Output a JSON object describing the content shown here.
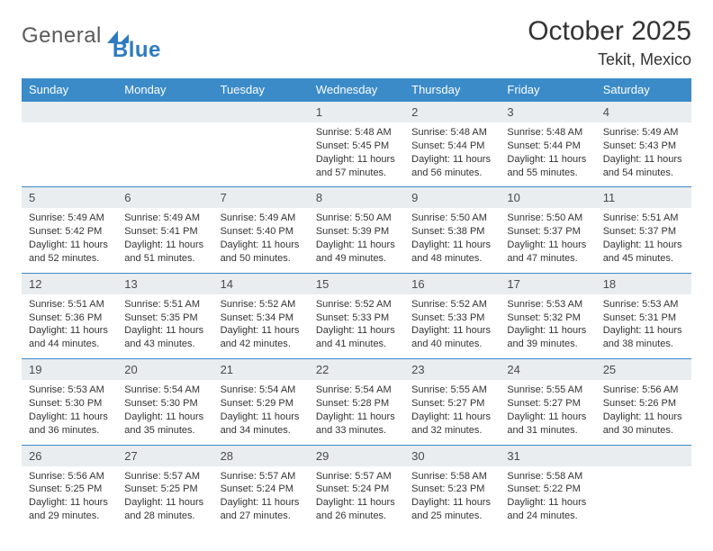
{
  "logo": {
    "word1": "General",
    "word2": "Blue"
  },
  "title": "October 2025",
  "location": "Tekit, Mexico",
  "dow": [
    "Sunday",
    "Monday",
    "Tuesday",
    "Wednesday",
    "Thursday",
    "Friday",
    "Saturday"
  ],
  "lead_blanks": 3,
  "days": [
    {
      "n": "1",
      "sr": "5:48 AM",
      "ss": "5:45 PM",
      "dl": "11 hours and 57 minutes."
    },
    {
      "n": "2",
      "sr": "5:48 AM",
      "ss": "5:44 PM",
      "dl": "11 hours and 56 minutes."
    },
    {
      "n": "3",
      "sr": "5:48 AM",
      "ss": "5:44 PM",
      "dl": "11 hours and 55 minutes."
    },
    {
      "n": "4",
      "sr": "5:49 AM",
      "ss": "5:43 PM",
      "dl": "11 hours and 54 minutes."
    },
    {
      "n": "5",
      "sr": "5:49 AM",
      "ss": "5:42 PM",
      "dl": "11 hours and 52 minutes."
    },
    {
      "n": "6",
      "sr": "5:49 AM",
      "ss": "5:41 PM",
      "dl": "11 hours and 51 minutes."
    },
    {
      "n": "7",
      "sr": "5:49 AM",
      "ss": "5:40 PM",
      "dl": "11 hours and 50 minutes."
    },
    {
      "n": "8",
      "sr": "5:50 AM",
      "ss": "5:39 PM",
      "dl": "11 hours and 49 minutes."
    },
    {
      "n": "9",
      "sr": "5:50 AM",
      "ss": "5:38 PM",
      "dl": "11 hours and 48 minutes."
    },
    {
      "n": "10",
      "sr": "5:50 AM",
      "ss": "5:37 PM",
      "dl": "11 hours and 47 minutes."
    },
    {
      "n": "11",
      "sr": "5:51 AM",
      "ss": "5:37 PM",
      "dl": "11 hours and 45 minutes."
    },
    {
      "n": "12",
      "sr": "5:51 AM",
      "ss": "5:36 PM",
      "dl": "11 hours and 44 minutes."
    },
    {
      "n": "13",
      "sr": "5:51 AM",
      "ss": "5:35 PM",
      "dl": "11 hours and 43 minutes."
    },
    {
      "n": "14",
      "sr": "5:52 AM",
      "ss": "5:34 PM",
      "dl": "11 hours and 42 minutes."
    },
    {
      "n": "15",
      "sr": "5:52 AM",
      "ss": "5:33 PM",
      "dl": "11 hours and 41 minutes."
    },
    {
      "n": "16",
      "sr": "5:52 AM",
      "ss": "5:33 PM",
      "dl": "11 hours and 40 minutes."
    },
    {
      "n": "17",
      "sr": "5:53 AM",
      "ss": "5:32 PM",
      "dl": "11 hours and 39 minutes."
    },
    {
      "n": "18",
      "sr": "5:53 AM",
      "ss": "5:31 PM",
      "dl": "11 hours and 38 minutes."
    },
    {
      "n": "19",
      "sr": "5:53 AM",
      "ss": "5:30 PM",
      "dl": "11 hours and 36 minutes."
    },
    {
      "n": "20",
      "sr": "5:54 AM",
      "ss": "5:30 PM",
      "dl": "11 hours and 35 minutes."
    },
    {
      "n": "21",
      "sr": "5:54 AM",
      "ss": "5:29 PM",
      "dl": "11 hours and 34 minutes."
    },
    {
      "n": "22",
      "sr": "5:54 AM",
      "ss": "5:28 PM",
      "dl": "11 hours and 33 minutes."
    },
    {
      "n": "23",
      "sr": "5:55 AM",
      "ss": "5:27 PM",
      "dl": "11 hours and 32 minutes."
    },
    {
      "n": "24",
      "sr": "5:55 AM",
      "ss": "5:27 PM",
      "dl": "11 hours and 31 minutes."
    },
    {
      "n": "25",
      "sr": "5:56 AM",
      "ss": "5:26 PM",
      "dl": "11 hours and 30 minutes."
    },
    {
      "n": "26",
      "sr": "5:56 AM",
      "ss": "5:25 PM",
      "dl": "11 hours and 29 minutes."
    },
    {
      "n": "27",
      "sr": "5:57 AM",
      "ss": "5:25 PM",
      "dl": "11 hours and 28 minutes."
    },
    {
      "n": "28",
      "sr": "5:57 AM",
      "ss": "5:24 PM",
      "dl": "11 hours and 27 minutes."
    },
    {
      "n": "29",
      "sr": "5:57 AM",
      "ss": "5:24 PM",
      "dl": "11 hours and 26 minutes."
    },
    {
      "n": "30",
      "sr": "5:58 AM",
      "ss": "5:23 PM",
      "dl": "11 hours and 25 minutes."
    },
    {
      "n": "31",
      "sr": "5:58 AM",
      "ss": "5:22 PM",
      "dl": "11 hours and 24 minutes."
    }
  ],
  "labels": {
    "sunrise": "Sunrise: ",
    "sunset": "Sunset: ",
    "daylight": "Daylight: "
  }
}
